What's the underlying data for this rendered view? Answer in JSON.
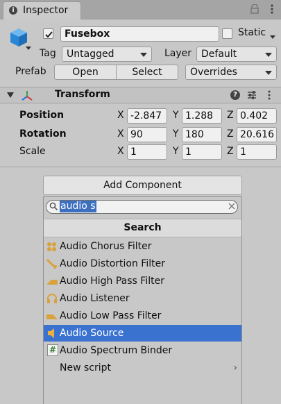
{
  "tab": {
    "title": "Inspector",
    "info_glyph": "i"
  },
  "header": {
    "active": true,
    "name": "Fusebox",
    "static_label": "Static",
    "static": false,
    "tag_label": "Tag",
    "tag_value": "Untagged",
    "layer_label": "Layer",
    "layer_value": "Default",
    "prefab_label": "Prefab",
    "open_label": "Open",
    "select_label": "Select",
    "overrides_label": "Overrides"
  },
  "transform": {
    "title": "Transform",
    "help_glyph": "?",
    "rows": [
      {
        "label": "Position",
        "x_axis": "X",
        "y_axis": "Y",
        "z_axis": "Z",
        "x": "-2.847",
        "y": "1.288",
        "z": "0.402"
      },
      {
        "label": "Rotation",
        "x_axis": "X",
        "y_axis": "Y",
        "z_axis": "Z",
        "x": "90",
        "y": "180",
        "z": "20.616"
      },
      {
        "label": "Scale",
        "x_axis": "X",
        "y_axis": "Y",
        "z_axis": "Z",
        "x": "1",
        "y": "1",
        "z": "1"
      }
    ]
  },
  "add_component": {
    "button_label": "Add Component",
    "search_value": "audio s",
    "results_header": "Search",
    "results": [
      {
        "label": "Audio Chorus Filter",
        "icon": "audio-chorus-filter-icon"
      },
      {
        "label": "Audio Distortion Filter",
        "icon": "audio-distortion-filter-icon"
      },
      {
        "label": "Audio High Pass Filter",
        "icon": "audio-high-pass-filter-icon"
      },
      {
        "label": "Audio Listener",
        "icon": "audio-listener-icon"
      },
      {
        "label": "Audio Low Pass Filter",
        "icon": "audio-low-pass-filter-icon"
      },
      {
        "label": "Audio Source",
        "icon": "audio-source-icon",
        "selected": true
      },
      {
        "label": "Audio Spectrum Binder",
        "icon": "script-hash-icon",
        "hash": "#"
      },
      {
        "label": "New script",
        "chevron": "›"
      }
    ]
  },
  "colors": {
    "selection": "#3a72d0",
    "accent_icon": "#d9a23a",
    "cube": "#2a86d6"
  }
}
